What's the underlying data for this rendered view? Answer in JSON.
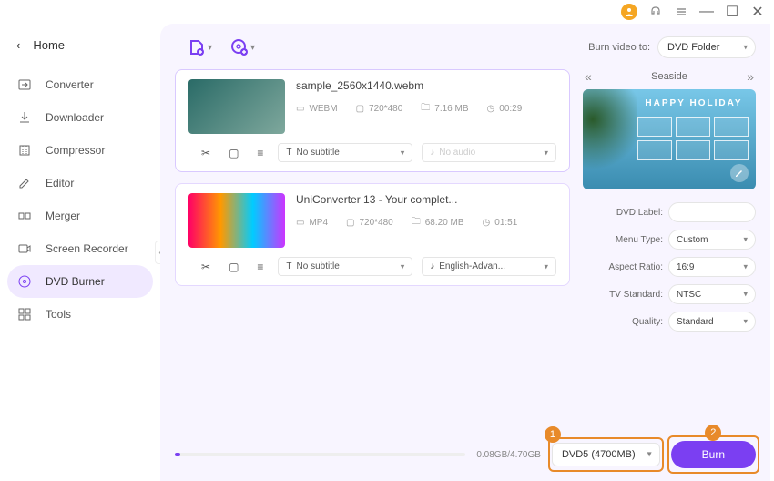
{
  "titlebar": {
    "close": "✕",
    "max": "☐",
    "min": "—"
  },
  "sidebar": {
    "home": "Home",
    "items": [
      {
        "label": "Converter",
        "icon": "converter"
      },
      {
        "label": "Downloader",
        "icon": "download"
      },
      {
        "label": "Compressor",
        "icon": "compress"
      },
      {
        "label": "Editor",
        "icon": "edit"
      },
      {
        "label": "Merger",
        "icon": "merge"
      },
      {
        "label": "Screen Recorder",
        "icon": "record"
      },
      {
        "label": "DVD Burner",
        "icon": "dvd"
      },
      {
        "label": "Tools",
        "icon": "tools"
      }
    ],
    "active_index": 6
  },
  "toolbar": {
    "burn_to_label": "Burn video to:",
    "burn_to_value": "DVD Folder"
  },
  "cards": [
    {
      "title": "sample_2560x1440.webm",
      "format": "WEBM",
      "resolution": "720*480",
      "size": "7.16 MB",
      "duration": "00:29",
      "subtitle": "No subtitle",
      "audio": "No audio",
      "audio_disabled": true
    },
    {
      "title": "UniConverter 13 - Your complet...",
      "format": "MP4",
      "resolution": "720*480",
      "size": "68.20 MB",
      "duration": "01:51",
      "subtitle": "No subtitle",
      "audio": "English-Advan...",
      "audio_disabled": false
    }
  ],
  "theme": {
    "name": "Seaside",
    "banner_text": "HAPPY HOLIDAY"
  },
  "settings": {
    "dvd_label_lbl": "DVD Label:",
    "dvd_label_val": "",
    "menu_type_lbl": "Menu Type:",
    "menu_type_val": "Custom",
    "aspect_lbl": "Aspect Ratio:",
    "aspect_val": "16:9",
    "tv_lbl": "TV Standard:",
    "tv_val": "NTSC",
    "quality_lbl": "Quality:",
    "quality_val": "Standard"
  },
  "footer": {
    "size_text": "0.08GB/4.70GB",
    "disc_value": "DVD5 (4700MB)",
    "burn_label": "Burn"
  },
  "highlights": {
    "num1": "1",
    "num2": "2"
  },
  "colors": {
    "accent": "#7b3ff2",
    "highlight": "#e88a2a"
  }
}
